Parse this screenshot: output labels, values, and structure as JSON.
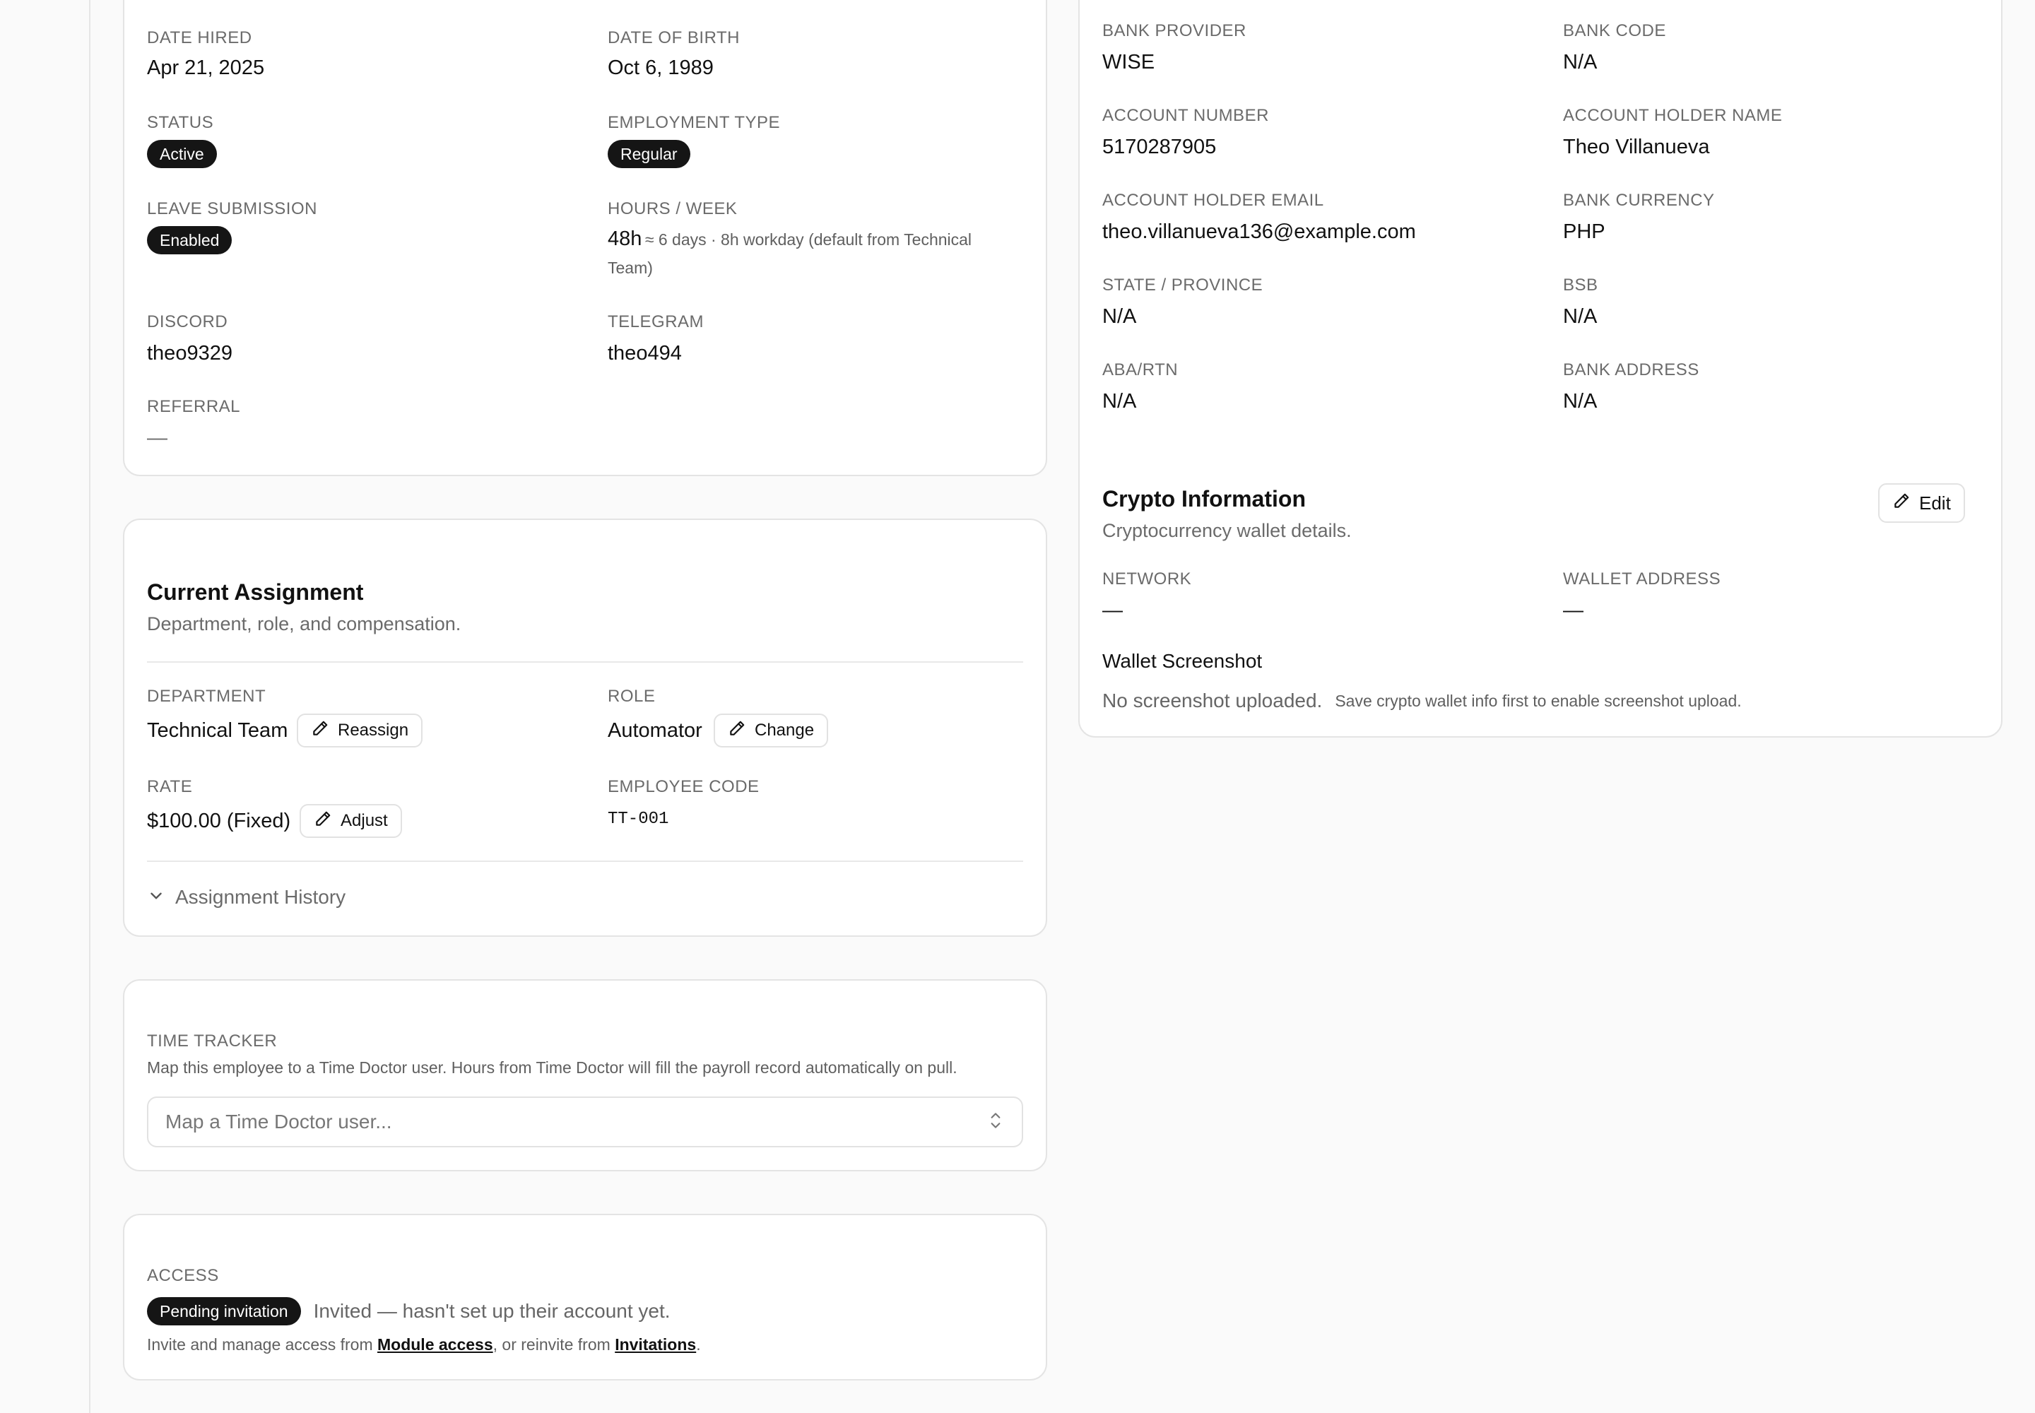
{
  "personal": {
    "date_hired_label": "DATE HIRED",
    "date_hired": "Apr 21, 2025",
    "dob_label": "DATE OF BIRTH",
    "dob": "Oct 6, 1989",
    "status_label": "STATUS",
    "status": "Active",
    "employment_type_label": "EMPLOYMENT TYPE",
    "employment_type": "Regular",
    "leave_label": "LEAVE SUBMISSION",
    "leave": "Enabled",
    "hours_label": "HOURS / WEEK",
    "hours": "48h",
    "hours_note_line1": "≈ 6 days · 8h workday (default from Technical",
    "hours_note_line2": "Team)",
    "discord_label": "DISCORD",
    "discord": "theo9329",
    "telegram_label": "TELEGRAM",
    "telegram": "theo494",
    "referral_label": "REFERRAL",
    "referral": "—"
  },
  "assignment": {
    "title": "Current Assignment",
    "subtitle": "Department, role, and compensation.",
    "department_label": "DEPARTMENT",
    "department": "Technical Team",
    "reassign_label": "Reassign",
    "role_label": "ROLE",
    "role": "Automator",
    "change_label": "Change",
    "rate_label": "RATE",
    "rate": "$100.00 (Fixed)",
    "adjust_label": "Adjust",
    "employee_code_label": "EMPLOYEE CODE",
    "employee_code": "TT-001",
    "history_label": "Assignment History"
  },
  "time_tracker": {
    "label": "TIME TRACKER",
    "description": "Map this employee to a Time Doctor user. Hours from Time Doctor will fill the payroll record automatically on pull.",
    "placeholder": "Map a Time Doctor user..."
  },
  "access": {
    "label": "ACCESS",
    "badge": "Pending invitation",
    "status_text": "Invited — hasn't set up their account yet.",
    "note_prefix": "Invite and manage access from ",
    "module_access_link": "Module access",
    "note_middle": ", or reinvite from ",
    "invitations_link": "Invitations",
    "note_suffix": "."
  },
  "bank": {
    "provider_label": "BANK PROVIDER",
    "provider": "WISE",
    "code_label": "BANK CODE",
    "code": "N/A",
    "account_number_label": "ACCOUNT NUMBER",
    "account_number": "5170287905",
    "holder_name_label": "ACCOUNT HOLDER NAME",
    "holder_name": "Theo Villanueva",
    "holder_email_label": "ACCOUNT HOLDER EMAIL",
    "holder_email": "theo.villanueva136@example.com",
    "currency_label": "BANK CURRENCY",
    "currency": "PHP",
    "state_label": "STATE / PROVINCE",
    "state": "N/A",
    "bsb_label": "BSB",
    "bsb": "N/A",
    "aba_label": "ABA/RTN",
    "aba": "N/A",
    "address_label": "BANK ADDRESS",
    "address": "N/A"
  },
  "crypto": {
    "title": "Crypto Information",
    "subtitle": "Cryptocurrency wallet details.",
    "edit_label": "Edit",
    "network_label": "NETWORK",
    "network": "—",
    "wallet_label": "WALLET ADDRESS",
    "wallet": "—",
    "screenshot_title": "Wallet Screenshot",
    "no_screenshot": "No screenshot uploaded.",
    "screenshot_hint": "Save crypto wallet info first to enable screenshot upload."
  },
  "icons": {
    "edit": "pencil-icon",
    "expand": "chevron-down-icon",
    "select": "chevron-up-down-icon"
  }
}
